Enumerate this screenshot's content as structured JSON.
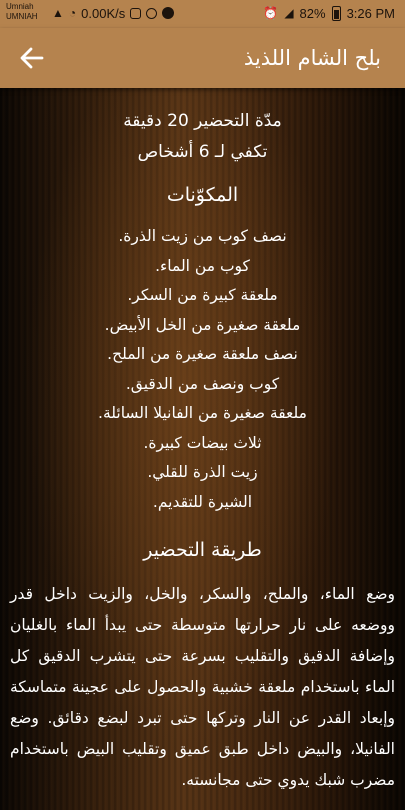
{
  "status_bar": {
    "carrier_line1": "Umniah",
    "carrier_line2": "UMNIAH",
    "speed": "0.00K/s",
    "battery": "82%",
    "time": "3:26 PM"
  },
  "app_bar": {
    "title": "بلح الشام اللذيذ",
    "back_icon": "arrow-left-icon"
  },
  "recipe": {
    "prep_time": "مدّة التحضير 20 دقيقة",
    "servings": "تكفي لـ 6 أشخاص",
    "ingredients_title": "المكوّنات",
    "ingredients": [
      "نصف كوب من زيت الذرة.",
      "كوب من الماء.",
      "ملعقة كبيرة من السكر.",
      "ملعقة صغيرة من الخل الأبيض.",
      "نصف ملعقة صغيرة من الملح.",
      "كوب ونصف من الدقيق.",
      "ملعقة صغيرة من الفانيلا السائلة.",
      "ثلاث بيضات كبيرة.",
      "زيت الذرة للقلي.",
      "الشيرة للتقديم."
    ],
    "method_title": "طريقة التحضير",
    "method_text": "وضع الماء، والملح، والسكر، والخل، والزيت داخل قدر ووضعه على نار حرارتها متوسطة حتى يبدأ الماء بالغليان وإضافة الدقيق والتقليب بسرعة حتى يتشرب الدقيق كل الماء باستخدام ملعقة خشبية والحصول على عجينة متماسكة وإبعاد القدر عن النار وتركها حتى تبرد لبضع دقائق. وضع الفانيلا، والبيض داخل طبق عميق وتقليب البيض باستخدام مضرب شبك يدوي حتى مجانسته."
  }
}
